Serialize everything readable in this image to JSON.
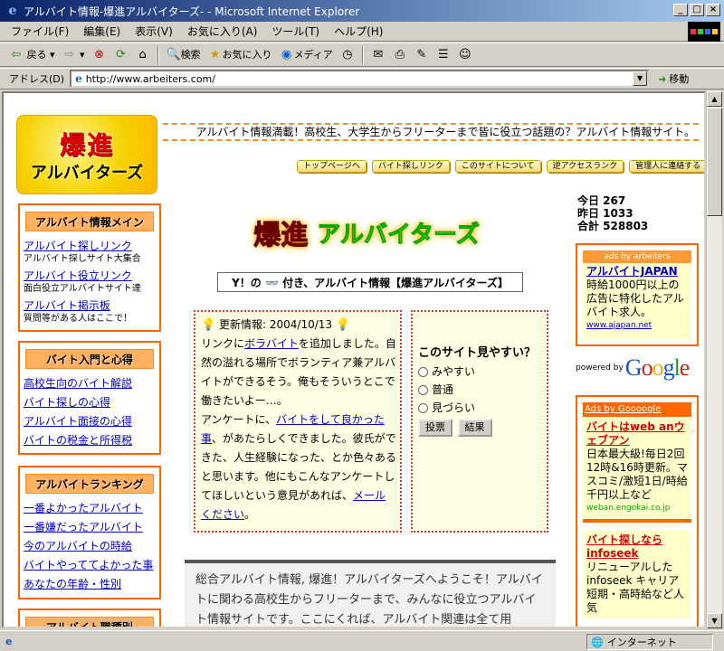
{
  "window": {
    "title": "アルバイト情報-爆進アルバイターズ- - Microsoft Internet Explorer"
  },
  "menu": [
    "ファイル(F)",
    "編集(E)",
    "表示(V)",
    "お気に入り(A)",
    "ツール(T)",
    "ヘルプ(H)"
  ],
  "toolbar": {
    "back": "戻る",
    "search": "検索",
    "favorites": "お気に入り",
    "media": "メディア"
  },
  "address": {
    "label": "アドレス(D)",
    "url": "http://www.arbeiters.com/",
    "go": "移動"
  },
  "status": {
    "zone": "インターネット"
  },
  "site": {
    "logo_top": "爆進",
    "logo_bottom": "アルバイターズ",
    "headline": "アルバイト情報満載！高校生、大学生からフリーターまで皆に役立つ話題の？アルバイト情報サイト。",
    "topnav": [
      "トップページへ",
      "バイト探しリンク",
      "このサイトについて",
      "逆アクセスランク",
      "管理人に連絡する"
    ],
    "counter": {
      "today": "今日 267",
      "yesterday": "昨日 1033",
      "total": "合計 528803"
    },
    "big_title_a": "爆進",
    "big_title_b": "アルバイターズ",
    "tagline": "Y！の 👓 付き、アルバイト情報【爆進アルバイターズ】"
  },
  "sidebar": {
    "box1": {
      "title": "アルバイト情報メイン",
      "items": [
        {
          "link": "アルバイト探しリンク",
          "note": "アルバイト探しサイト大集合"
        },
        {
          "link": "アルバイト役立リンク",
          "note": "面白役立アルバイトサイト達"
        },
        {
          "link": "アルバイト掲示板",
          "note": "質問等がある人はここで！"
        }
      ]
    },
    "box2": {
      "title": "バイト入門と心得",
      "items": [
        "高校生向のバイト解説",
        "バイト探しの心得",
        "アルバイト面接の心得",
        "バイトの税金と所得税"
      ]
    },
    "box3": {
      "title": "アルバイトランキング",
      "items": [
        "一番よかったアルバイト",
        "一番嫌だったアルバイト",
        "今のアルバイトの時給",
        "バイトやっててよかった事",
        "あなたの年齢・性別"
      ]
    },
    "box4": {
      "title": "アルバイト職種別"
    }
  },
  "news": {
    "heading": "更新情報: 2004/10/13",
    "p1a": "リンクに",
    "p1link": "ボラバイト",
    "p1b": "を追加しました。自然の溢れる場所でボランティア兼アルバイトができるそう。俺もそういうとこで働きたいよー…。",
    "p2a": "アンケートに、",
    "p2link": "バイトをして良かった事",
    "p2b": "、があたらしくできました。彼氏ができた、人生経験になった、とか色々あると思います。他にもこんなアンケートしてほしいという意見があれば、",
    "p2link2": "メールください",
    "p2c": "。"
  },
  "poll": {
    "question": "このサイト見やすい？",
    "options": [
      "みやすい",
      "普通",
      "見づらい"
    ],
    "vote": "投票",
    "result": "結果"
  },
  "welcome": "総合アルバイト情報, 爆進！アルバイターズへようこそ！アルバイトに関わる高校生からフリーターまで、みんなに役立つアルバイト情報サイトです。ここにくれば、アルバイト関連は全て用",
  "ads1": {
    "header": "ads by arbeiters",
    "title": "アルバイトJAPAN",
    "body": "時給1000円以上の広告に特化したアルバイト求人。",
    "url": "www.ajapan.net"
  },
  "google": {
    "powered": "powered by",
    "brand": "Google"
  },
  "ads2": {
    "header": "Ads by Goooogle",
    "items": [
      {
        "title": "バイトはweb anウェブアン",
        "body": "日本最大級!毎日2回12時&16時更新。マスコミ/激短1日/時給千円以上など",
        "url": "weban.engokai.co.jp"
      },
      {
        "title": "バイト探しなら infoseek",
        "body": "リニューアルした infoseek キャリア 短期・高時給など人気",
        "url": ""
      }
    ]
  }
}
